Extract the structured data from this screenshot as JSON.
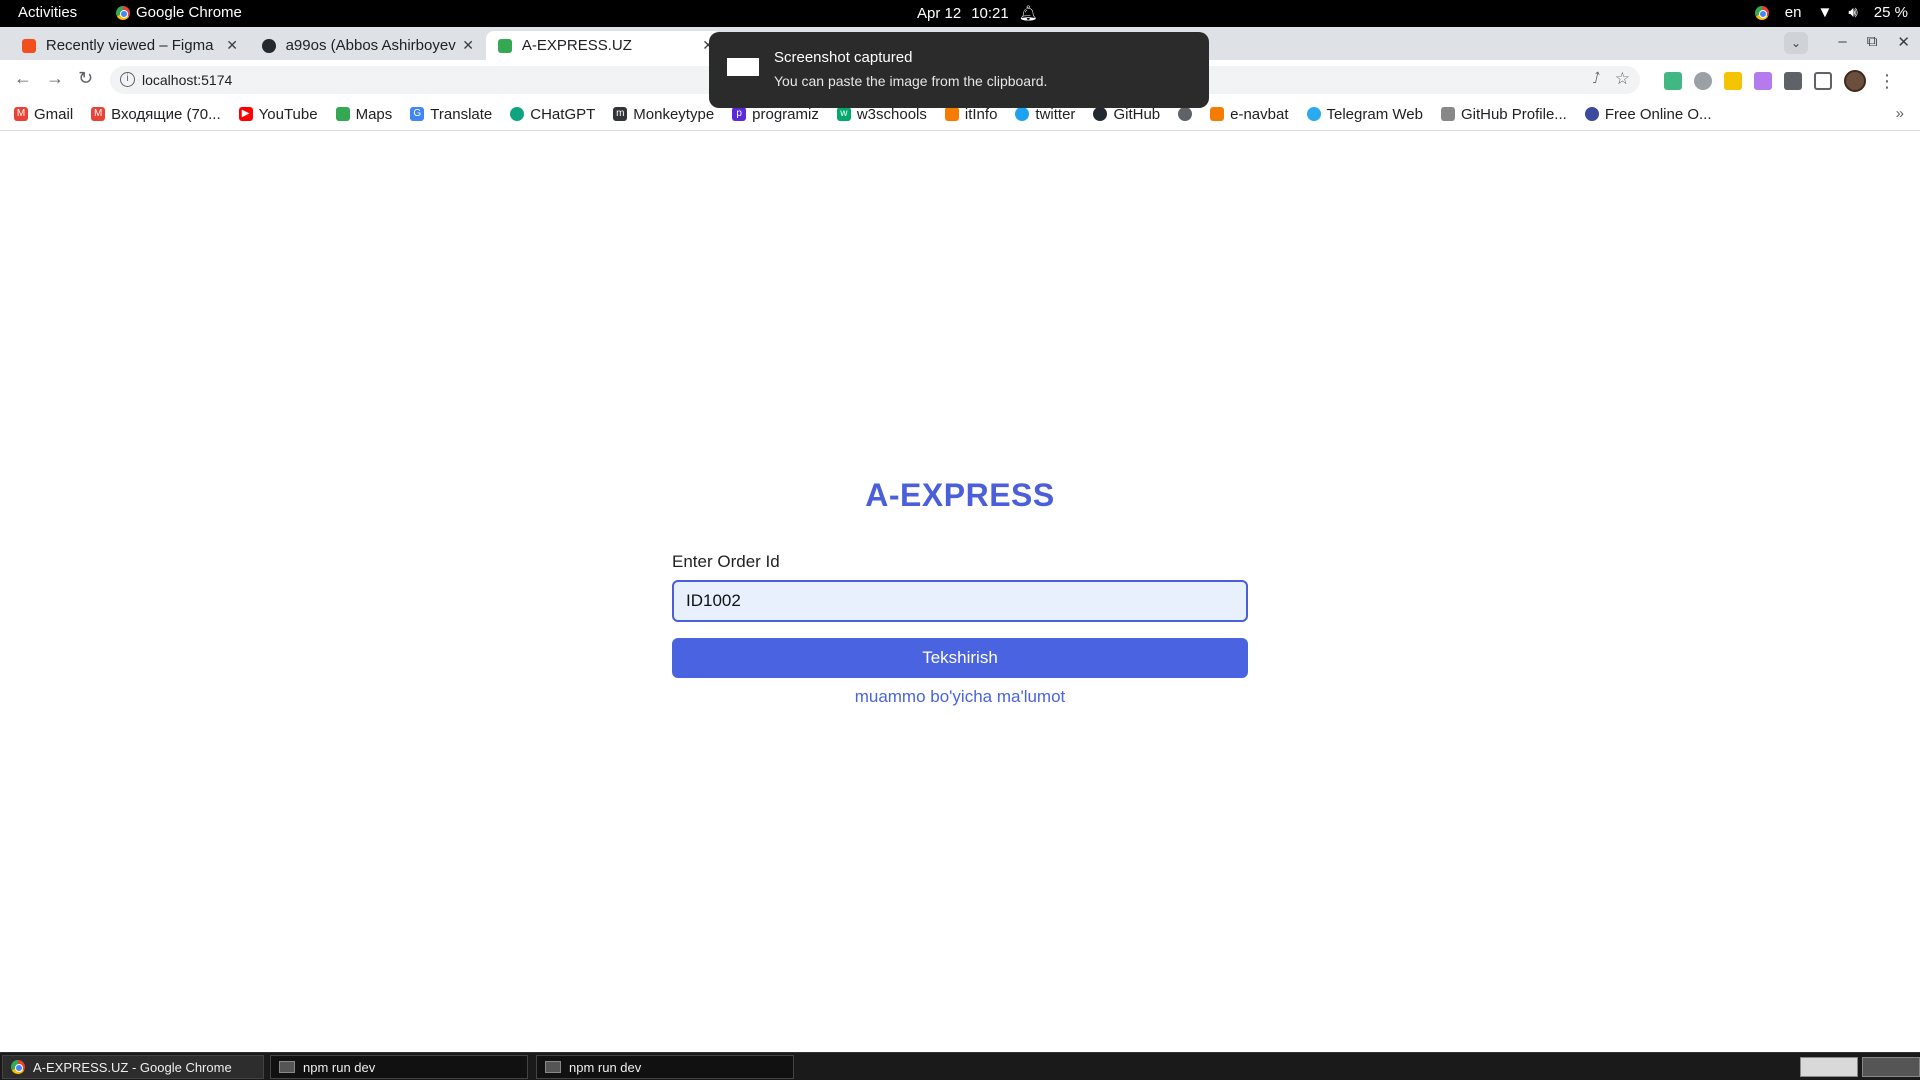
{
  "topbar": {
    "activities": "Activities",
    "app_name": "Google Chrome",
    "date": "Apr 12",
    "time": "10:21",
    "language": "en",
    "battery": "25 %"
  },
  "tabs": [
    {
      "title": "Recently viewed – Figma",
      "color": "#f24e1e"
    },
    {
      "title": "a99os (Abbos Ashirboyev",
      "color": "#24292f"
    },
    {
      "title": "A-EXPRESS.UZ",
      "color": "#34a853"
    }
  ],
  "toolbar": {
    "url": "localhost:5174"
  },
  "bookmarks": [
    {
      "label": "Gmail",
      "icon": "gmail-icon",
      "color": "#ea4335"
    },
    {
      "label": "Входящие (70...",
      "icon": "mail-icon",
      "color": "#ea4335"
    },
    {
      "label": "YouTube",
      "icon": "youtube-icon",
      "color": "#ff0000"
    },
    {
      "label": "Maps",
      "icon": "maps-icon",
      "color": "#34a853"
    },
    {
      "label": "Translate",
      "icon": "translate-icon",
      "color": "#4285f4"
    },
    {
      "label": "CHatGPT",
      "icon": "chatgpt-icon",
      "color": "#10a37f"
    },
    {
      "label": "Monkeytype",
      "icon": "monkeytype-icon",
      "color": "#323437"
    },
    {
      "label": "programiz",
      "icon": "programiz-icon",
      "color": "#5b2bd9"
    },
    {
      "label": "w3schools",
      "icon": "w3schools-icon",
      "color": "#04aa6d"
    },
    {
      "label": "itInfo",
      "icon": "itinfo-icon",
      "color": "#f57c00"
    },
    {
      "label": "twitter",
      "icon": "twitter-icon",
      "color": "#1da1f2"
    },
    {
      "label": "GitHub",
      "icon": "github-icon",
      "color": "#24292f"
    },
    {
      "label": "",
      "icon": "globe-icon",
      "color": "#5f6368"
    },
    {
      "label": "e-navbat",
      "icon": "enavbat-icon",
      "color": "#f57c00"
    },
    {
      "label": "Telegram Web",
      "icon": "telegram-icon",
      "color": "#2aabee"
    },
    {
      "label": "GitHub Profile...",
      "icon": "github-profile-icon",
      "color": "#888888"
    },
    {
      "label": "Free Online O...",
      "icon": "free-online-icon",
      "color": "#3b4a9c"
    }
  ],
  "notification": {
    "title": "Screenshot captured",
    "body": "You can paste the image from the clipboard."
  },
  "page": {
    "brand": "A-EXPRESS",
    "label": "Enter Order Id",
    "input_value": "ID1002",
    "button_label": "Tekshirish",
    "help_link": "muammo bo'yicha ma'lumot",
    "accent": "#4a63e0"
  },
  "taskbar": [
    {
      "label": "A-EXPRESS.UZ - Google Chrome"
    },
    {
      "label": "npm run dev"
    },
    {
      "label": "npm run dev"
    }
  ]
}
